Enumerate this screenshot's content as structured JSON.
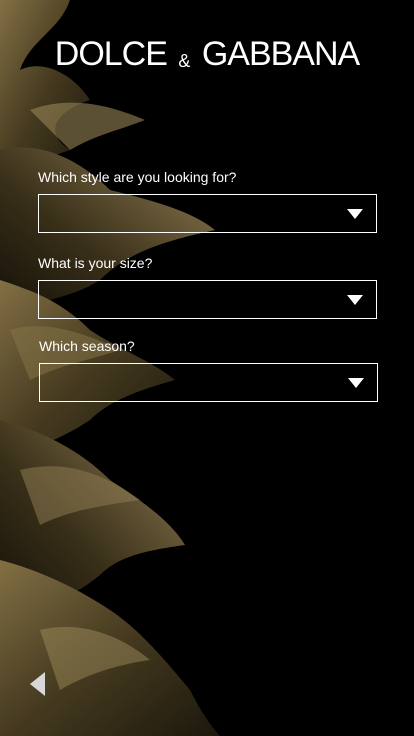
{
  "brand": {
    "left": "DOLCE",
    "amp": "&",
    "right": "GABBANA"
  },
  "form": {
    "style": {
      "label": "Which style are you looking for?",
      "value": ""
    },
    "size": {
      "label": "What is your size?",
      "value": ""
    },
    "season": {
      "label": "Which season?",
      "value": ""
    }
  },
  "icons": {
    "dropdown": "triangle-down-icon",
    "back": "triangle-left-icon"
  },
  "colors": {
    "background": "#000000",
    "text": "#ffffff",
    "leaf": "#6b5a36"
  }
}
